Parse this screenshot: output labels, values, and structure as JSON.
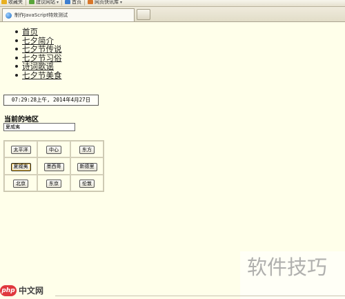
{
  "toolbar": {
    "items": [
      {
        "label": "收藏夹",
        "has_arrow": false,
        "icon_color": "#e8b020"
      },
      {
        "label": "建议网站",
        "has_arrow": true,
        "icon_color": "#5aa53a"
      },
      {
        "label": "首页",
        "has_arrow": false,
        "icon_color": "#3e7fd0"
      },
      {
        "label": "网页快讯库",
        "has_arrow": true,
        "icon_color": "#d8762a"
      }
    ]
  },
  "tab": {
    "title": "制作JavaScript特效测试"
  },
  "nav": {
    "items": [
      "首页",
      "七夕简介",
      "七夕节传说",
      "七夕节习俗",
      "诗词歌谣",
      "七夕节美食"
    ]
  },
  "clock": {
    "text": "07:29:28上午, 2014年4月27日"
  },
  "region": {
    "label": "当前的地区",
    "value": "夏威夷"
  },
  "cities": {
    "rows": [
      [
        "太平洋",
        "中心",
        "东方"
      ],
      [
        "夏威夷",
        "墨西哥",
        "新德里"
      ],
      [
        "北京",
        "东京",
        "伦敦"
      ]
    ],
    "selected": "夏威夷"
  },
  "watermarks": {
    "right": "软件技巧",
    "logo": "php",
    "left": "中文网"
  }
}
